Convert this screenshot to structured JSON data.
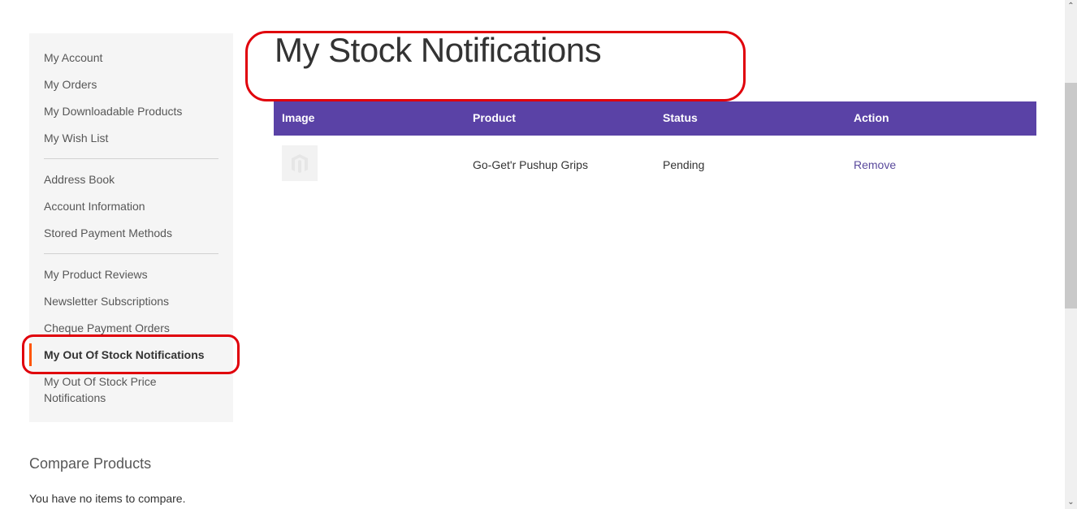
{
  "sidebar": {
    "groups": [
      [
        {
          "label": "My Account"
        },
        {
          "label": "My Orders"
        },
        {
          "label": "My Downloadable Products"
        },
        {
          "label": "My Wish List"
        }
      ],
      [
        {
          "label": "Address Book"
        },
        {
          "label": "Account Information"
        },
        {
          "label": "Stored Payment Methods"
        }
      ],
      [
        {
          "label": "My Product Reviews"
        },
        {
          "label": "Newsletter Subscriptions"
        },
        {
          "label": "Cheque Payment Orders"
        },
        {
          "label": "My Out Of Stock Notifications",
          "active": true
        },
        {
          "label": "My Out Of Stock Price Notifications"
        }
      ]
    ],
    "active_color": "#ff5501"
  },
  "compare": {
    "title": "Compare Products",
    "empty_text": "You have no items to compare."
  },
  "main": {
    "title": "My Stock Notifications",
    "table": {
      "header_color": "#5a42a6",
      "columns": [
        "Image",
        "Product",
        "Status",
        "Action"
      ],
      "rows": [
        {
          "image": "product-placeholder-icon",
          "product": "Go-Get'r Pushup Grips",
          "status": "Pending",
          "action": "Remove"
        }
      ]
    }
  },
  "annotations": {
    "color": "#e0000b",
    "highlighted": [
      "page-title",
      "sidebar-item-my-out-of-stock-notifications"
    ]
  },
  "scrollbar": {
    "up_icon": "chevron-up-icon",
    "down_icon": "chevron-down-icon"
  }
}
